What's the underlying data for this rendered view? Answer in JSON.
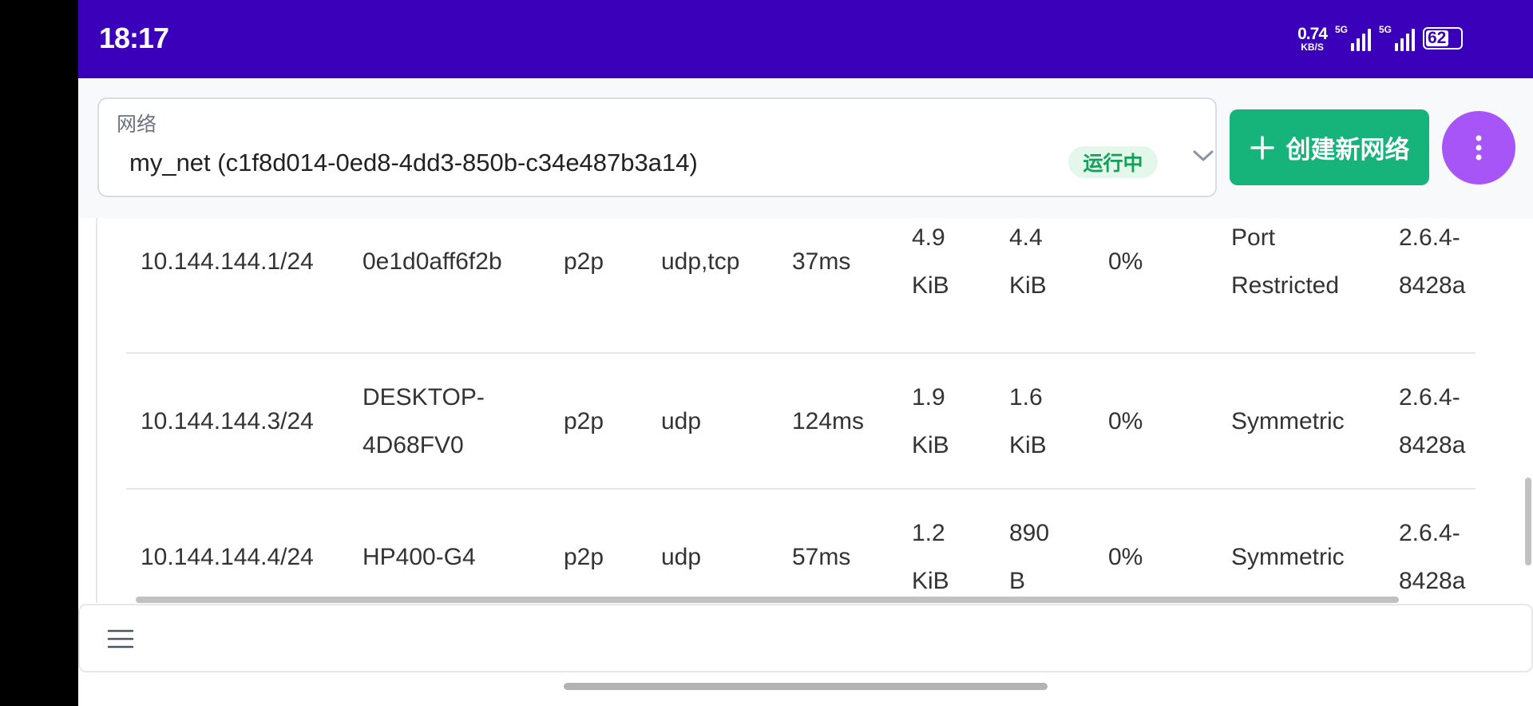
{
  "status_bar": {
    "time": "18:17",
    "net_speed_value": "0.74",
    "net_speed_unit": "KB/S",
    "signal1_tag": "5G",
    "signal2_tag": "5G",
    "battery": "62"
  },
  "network_select": {
    "label": "网络",
    "value": "my_net (c1f8d014-0ed8-4dd3-850b-c34e487b3a14)",
    "status": "运行中"
  },
  "create_button": {
    "label": "创建新网络"
  },
  "colors": {
    "status_bar": "#3b00b9",
    "create": "#16b47a",
    "more": "#a855f7",
    "running": "#12a05a"
  },
  "peers": [
    {
      "ip": "10.144.144.1/24",
      "host": [
        "0e1d0aff6f2b"
      ],
      "cost": "p2p",
      "tunnel": "udp,tcp",
      "latency": "37ms",
      "rx": [
        "4.9",
        "KiB"
      ],
      "tx": [
        "4.4",
        "KiB"
      ],
      "loss": "0%",
      "nat": [
        "Port",
        "Restricted"
      ],
      "version": [
        "2.6.4-",
        "8428a"
      ]
    },
    {
      "ip": "10.144.144.3/24",
      "host": [
        "DESKTOP-",
        "4D68FV0"
      ],
      "cost": "p2p",
      "tunnel": "udp",
      "latency": "124ms",
      "rx": [
        "1.9",
        "KiB"
      ],
      "tx": [
        "1.6",
        "KiB"
      ],
      "loss": "0%",
      "nat": [
        "Symmetric"
      ],
      "version": [
        "2.6.4-",
        "8428a"
      ]
    },
    {
      "ip": "10.144.144.4/24",
      "host": [
        "HP400-G4"
      ],
      "cost": "p2p",
      "tunnel": "udp",
      "latency": "57ms",
      "rx": [
        "1.2",
        "KiB"
      ],
      "tx": [
        "890",
        "B"
      ],
      "loss": "0%",
      "nat": [
        "Symmetric"
      ],
      "version": [
        "2.6.4-",
        "8428a"
      ]
    }
  ]
}
